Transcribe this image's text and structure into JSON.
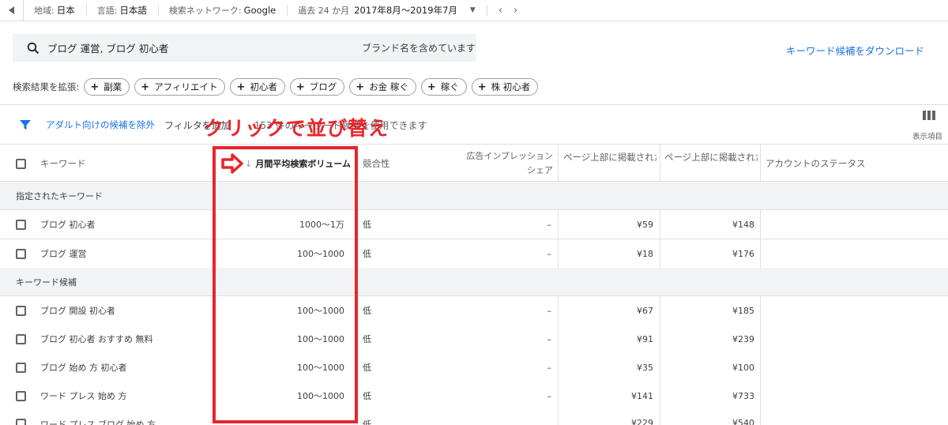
{
  "topbar": {
    "region_label": "地域:",
    "region_value": "日本",
    "language_label": "言語:",
    "language_value": "日本語",
    "network_label": "検索ネットワーク:",
    "network_value": "Google",
    "period_label": "過去 24 か月",
    "period_value": "2017年8月～2019年7月"
  },
  "search": {
    "query": "ブログ 運営, ブログ 初心者",
    "brand_filter": "ブランド名を含めています"
  },
  "download_link": "キーワード候補をダウンロード",
  "expand": {
    "label": "検索結果を拡張:",
    "chips": [
      "副業",
      "アフィリエイト",
      "初心者",
      "ブログ",
      "お金 稼ぐ",
      "稼ぐ",
      "株 初心者"
    ]
  },
  "filter": {
    "exclude_adult": "アダルト向けの候補を除外",
    "add_filter": "フィルタを追加",
    "count_text": "153 件のキーワード候補を使用できます"
  },
  "columns_label": "表示項目",
  "table": {
    "headers": {
      "keyword": "キーワード",
      "volume": "月間平均検索ボリューム",
      "competition": "競合性",
      "impression_share_1": "広告インプレッション",
      "impression_share_2": "シェア",
      "top_bid_low": "ページ上部に掲載された",
      "top_bid_high": "ページ上部に掲載された",
      "account_status": "アカウントのステータス"
    },
    "section_specified": "指定されたキーワード",
    "section_ideas": "キーワード候補",
    "rows": [
      {
        "keyword": "ブログ 初心者",
        "volume": "1000～1万",
        "competition": "低",
        "share": "–",
        "bid_low": "¥59",
        "bid_high": "¥148"
      },
      {
        "keyword": "ブログ 運営",
        "volume": "100～1000",
        "competition": "低",
        "share": "–",
        "bid_low": "¥18",
        "bid_high": "¥176"
      },
      {
        "keyword": "ブログ 開設 初心者",
        "volume": "100～1000",
        "competition": "低",
        "share": "–",
        "bid_low": "¥67",
        "bid_high": "¥185"
      },
      {
        "keyword": "ブログ 初心者 おすすめ 無料",
        "volume": "100～1000",
        "competition": "低",
        "share": "–",
        "bid_low": "¥91",
        "bid_high": "¥239"
      },
      {
        "keyword": "ブログ 始め 方 初心者",
        "volume": "100～1000",
        "competition": "低",
        "share": "–",
        "bid_low": "¥35",
        "bid_high": "¥100"
      },
      {
        "keyword": "ワード プレス 始め 方",
        "volume": "100～1000",
        "competition": "低",
        "share": "–",
        "bid_low": "¥141",
        "bid_high": "¥733"
      },
      {
        "keyword": "ワード プレス ブログ 始め 方",
        "volume": "",
        "competition": "低",
        "share": "",
        "bid_low": "¥229",
        "bid_high": "¥540"
      }
    ]
  },
  "annotation": {
    "text": "クリックで並び替え",
    "color": "#e8252b"
  },
  "colors": {
    "accent": "#1a73e8",
    "annotation": "#e8252b"
  }
}
